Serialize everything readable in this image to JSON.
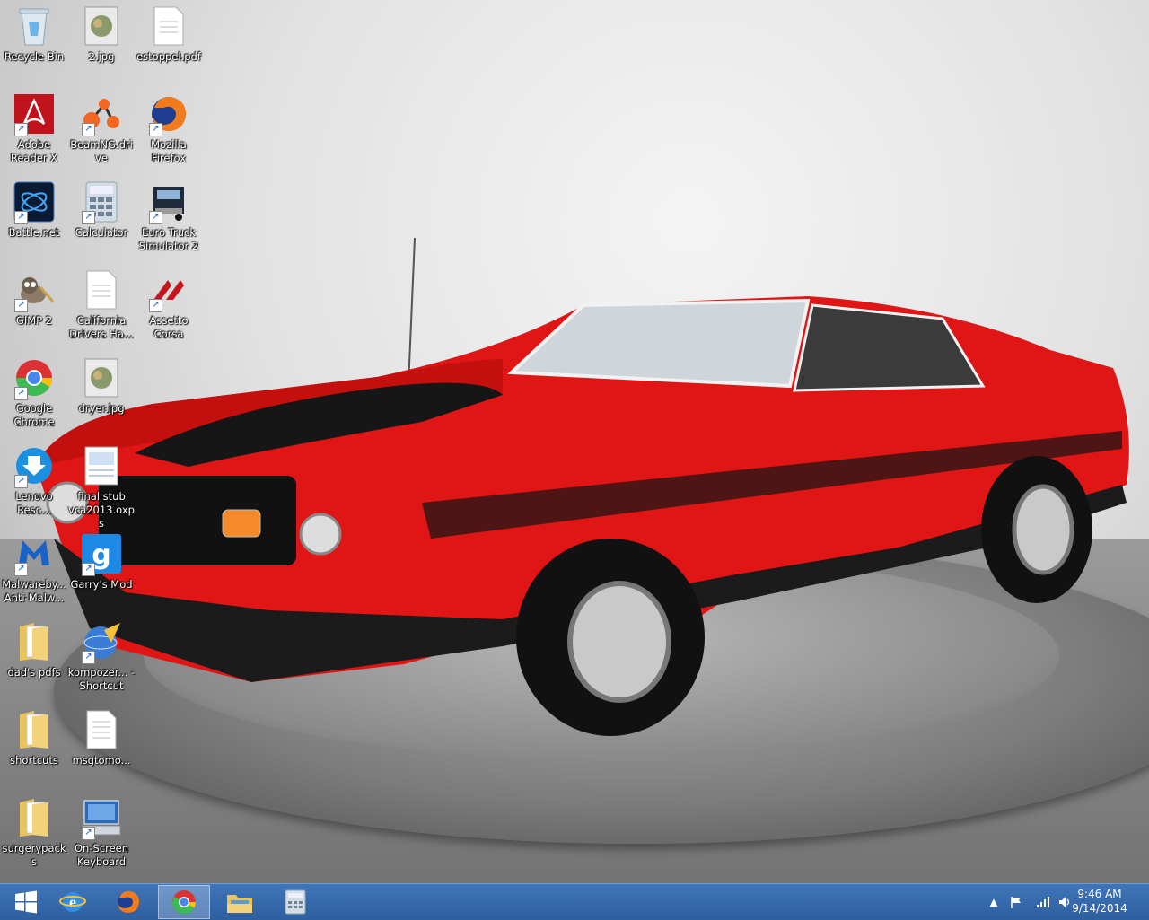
{
  "desktop": {
    "icons": [
      {
        "label": "Recycle Bin",
        "icon": "recycle-bin-icon"
      },
      {
        "label": "2.jpg",
        "icon": "image-file-icon"
      },
      {
        "label": "estoppel.pdf",
        "icon": "document-file-icon"
      },
      {
        "label": "Adobe Reader X",
        "icon": "adobe-reader-icon"
      },
      {
        "label": "BeamNG.drive",
        "icon": "beamng-icon"
      },
      {
        "label": "Mozilla Firefox",
        "icon": "firefox-icon"
      },
      {
        "label": "Battle.net",
        "icon": "battlenet-icon"
      },
      {
        "label": "Calculator",
        "icon": "calculator-icon"
      },
      {
        "label": "Euro Truck Simulator 2",
        "icon": "truck-icon"
      },
      {
        "label": "GIMP 2",
        "icon": "gimp-icon"
      },
      {
        "label": "California Drivers Ha...",
        "icon": "document-file-icon"
      },
      {
        "label": "Assetto Corsa",
        "icon": "assetto-corsa-icon"
      },
      {
        "label": "Google Chrome",
        "icon": "chrome-icon"
      },
      {
        "label": "dryer.jpg",
        "icon": "image-file-icon"
      },
      {
        "label": "Lenovo Resc...",
        "icon": "lenovo-rescue-icon"
      },
      {
        "label": "final stub vca2013.oxps",
        "icon": "oxps-file-icon"
      },
      {
        "label": "Malwareby... Anti-Malw...",
        "icon": "malwarebytes-icon"
      },
      {
        "label": "Garry's Mod",
        "icon": "garrys-mod-icon"
      },
      {
        "label": "dad's pdfs",
        "icon": "folder-icon"
      },
      {
        "label": "kompozer... - Shortcut",
        "icon": "kompozer-icon"
      },
      {
        "label": "shortcuts",
        "icon": "folder-icon"
      },
      {
        "label": "msgtomo...",
        "icon": "text-file-icon"
      },
      {
        "label": "surgerypacks",
        "icon": "folder-icon"
      },
      {
        "label": "On-Screen Keyboard",
        "icon": "keyboard-icon"
      }
    ]
  },
  "taskbar": {
    "start": "windows-logo-icon",
    "pinned": [
      {
        "name": "internet-explorer-icon"
      },
      {
        "name": "firefox-icon"
      },
      {
        "name": "chrome-icon",
        "active": true
      },
      {
        "name": "file-explorer-icon"
      },
      {
        "name": "calculator-icon"
      }
    ],
    "tray": [
      "show-hidden-icons",
      "action-center-flag",
      "network-signal",
      "volume"
    ],
    "clock": {
      "time": "9:46 AM",
      "date": "9/14/2014"
    }
  },
  "colors": {
    "taskbar": "#3567a8",
    "car": "#e01515"
  }
}
